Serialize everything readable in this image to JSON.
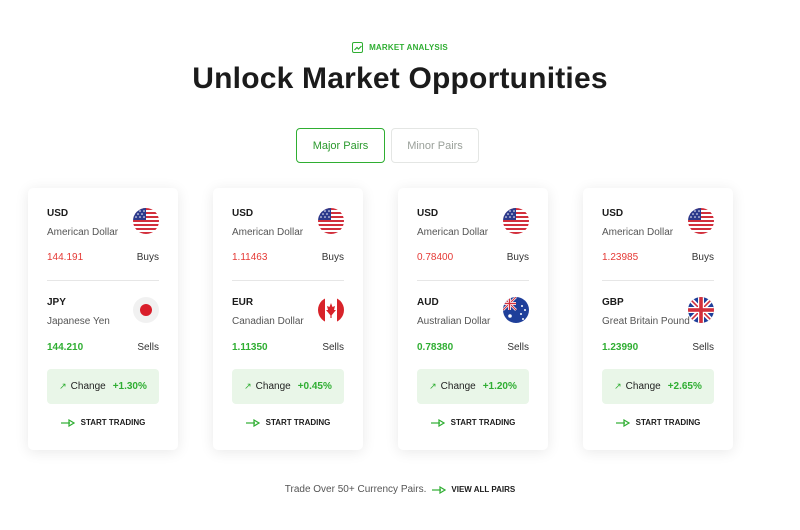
{
  "eyebrow": {
    "label": "MARKET ANALYSIS",
    "icon": "chart-trend-icon"
  },
  "heading": "Unlock Market Opportunities",
  "tabs": [
    {
      "label": "Major Pairs",
      "active": true
    },
    {
      "label": "Minor Pairs",
      "active": false
    }
  ],
  "cards": [
    {
      "base": {
        "code": "USD",
        "name": "American Dollar",
        "price": "144.191",
        "side": "Buys",
        "flag": "us-flag-icon"
      },
      "quote": {
        "code": "JPY",
        "name": "Japanese Yen",
        "price": "144.210",
        "side": "Sells",
        "flag": "jp-flag-icon"
      },
      "change_label": "Change",
      "change_value": "+1.30%",
      "cta": "START TRADING"
    },
    {
      "base": {
        "code": "USD",
        "name": "American Dollar",
        "price": "1.11463",
        "side": "Buys",
        "flag": "us-flag-icon"
      },
      "quote": {
        "code": "EUR",
        "name": "Canadian Dollar",
        "price": "1.11350",
        "side": "Sells",
        "flag": "ca-flag-icon"
      },
      "change_label": "Change",
      "change_value": "+0.45%",
      "cta": "START TRADING"
    },
    {
      "base": {
        "code": "USD",
        "name": "American Dollar",
        "price": "0.78400",
        "side": "Buys",
        "flag": "us-flag-icon"
      },
      "quote": {
        "code": "AUD",
        "name": "Australian Dollar",
        "price": "0.78380",
        "side": "Sells",
        "flag": "au-flag-icon"
      },
      "change_label": "Change",
      "change_value": "+1.20%",
      "cta": "START TRADING"
    },
    {
      "base": {
        "code": "USD",
        "name": "American Dollar",
        "price": "1.23985",
        "side": "Buys",
        "flag": "us-flag-icon"
      },
      "quote": {
        "code": "GBP",
        "name": "Great Britain Pound",
        "price": "1.23990",
        "side": "Sells",
        "flag": "gb-flag-icon"
      },
      "change_label": "Change",
      "change_value": "+2.65%",
      "cta": "START TRADING"
    }
  ],
  "footer": {
    "text": "Trade Over 50+ Currency Pairs.",
    "link": "VIEW ALL PAIRS"
  },
  "colors": {
    "accent": "#2fae32",
    "sell_price": "#e53935",
    "change_bg": "#e9f6e8"
  }
}
